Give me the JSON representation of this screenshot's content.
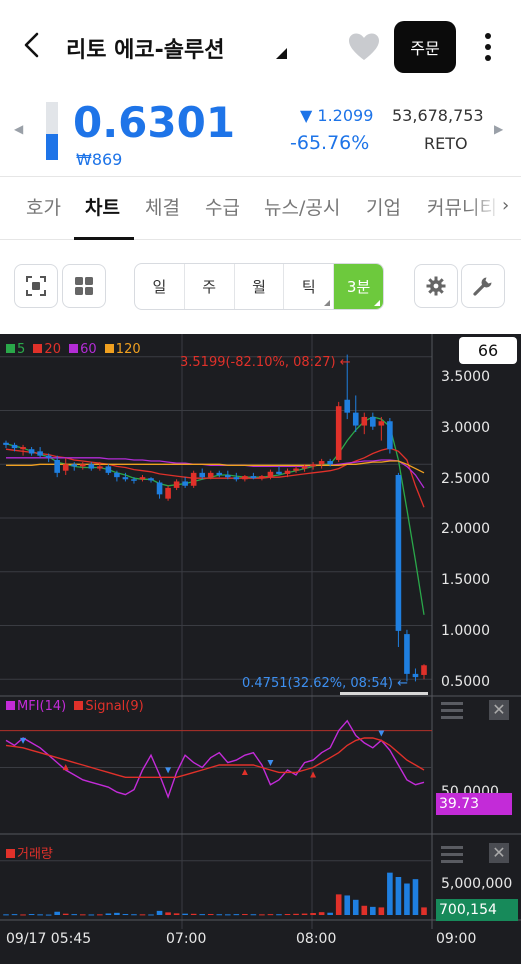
{
  "header": {
    "title": "리토 에코-솔루션",
    "order_label": "주문"
  },
  "quote": {
    "price": "0.6301",
    "prev_close": "₩869",
    "change": "▼ 1.2099",
    "change_rate": "-65.76%",
    "volume": "53,678,753",
    "ticker": "RETO",
    "gauge_level": 0.45
  },
  "tabs": [
    "호가",
    "차트",
    "체결",
    "수급",
    "뉴스/공시",
    "기업",
    "커뮤니티"
  ],
  "active_tab": "차트",
  "periods": [
    "일",
    "주",
    "월",
    "틱",
    "3분"
  ],
  "active_period": "3분",
  "chart": {
    "ma_legend": [
      {
        "label": "5",
        "color": "#2aa84a"
      },
      {
        "label": "20",
        "color": "#e0312a"
      },
      {
        "label": "60",
        "color": "#b32cd6"
      },
      {
        "label": "120",
        "color": "#f0a020"
      }
    ],
    "count_box": "66",
    "high_label": "3.5199(-82.10%, 08:27)",
    "low_label": "0.4751(32.62%, 08:54)",
    "price_ticks": [
      "3.5000",
      "3.0000",
      "2.5000",
      "2.0000",
      "1.5000",
      "1.0000",
      "0.5000"
    ],
    "mfi_legend": [
      "MFI(14)",
      "Signal(9)"
    ],
    "mfi_tick": "50.0000",
    "mfi_value": "39.73",
    "volume_legend": "거래량",
    "volume_tick": "5,000,000",
    "volume_value": "700,154",
    "x_labels": [
      "09/17 05:45",
      "07:00",
      "08:00",
      "09:00"
    ]
  },
  "chart_data": {
    "type": "candlestick",
    "interval": "3분",
    "ylim": [
      0.4,
      3.6
    ],
    "candles": [
      {
        "o": 2.7,
        "h": 2.72,
        "l": 2.65,
        "c": 2.68
      },
      {
        "o": 2.68,
        "h": 2.7,
        "l": 2.62,
        "c": 2.65
      },
      {
        "o": 2.64,
        "h": 2.68,
        "l": 2.58,
        "c": 2.66
      },
      {
        "o": 2.64,
        "h": 2.66,
        "l": 2.58,
        "c": 2.6
      },
      {
        "o": 2.62,
        "h": 2.66,
        "l": 2.56,
        "c": 2.58
      },
      {
        "o": 2.58,
        "h": 2.6,
        "l": 2.52,
        "c": 2.56
      },
      {
        "o": 2.54,
        "h": 2.58,
        "l": 2.38,
        "c": 2.42
      },
      {
        "o": 2.44,
        "h": 2.56,
        "l": 2.4,
        "c": 2.5
      },
      {
        "o": 2.5,
        "h": 2.52,
        "l": 2.44,
        "c": 2.48
      },
      {
        "o": 2.48,
        "h": 2.52,
        "l": 2.45,
        "c": 2.5
      },
      {
        "o": 2.5,
        "h": 2.52,
        "l": 2.44,
        "c": 2.46
      },
      {
        "o": 2.46,
        "h": 2.52,
        "l": 2.44,
        "c": 2.48
      },
      {
        "o": 2.48,
        "h": 2.5,
        "l": 2.4,
        "c": 2.42
      },
      {
        "o": 2.42,
        "h": 2.44,
        "l": 2.34,
        "c": 2.38
      },
      {
        "o": 2.38,
        "h": 2.42,
        "l": 2.34,
        "c": 2.36
      },
      {
        "o": 2.36,
        "h": 2.38,
        "l": 2.32,
        "c": 2.35
      },
      {
        "o": 2.36,
        "h": 2.4,
        "l": 2.34,
        "c": 2.38
      },
      {
        "o": 2.37,
        "h": 2.38,
        "l": 2.33,
        "c": 2.35
      },
      {
        "o": 2.33,
        "h": 2.35,
        "l": 2.18,
        "c": 2.22
      },
      {
        "o": 2.18,
        "h": 2.3,
        "l": 2.16,
        "c": 2.28
      },
      {
        "o": 2.28,
        "h": 2.36,
        "l": 2.26,
        "c": 2.34
      },
      {
        "o": 2.34,
        "h": 2.38,
        "l": 2.28,
        "c": 2.3
      },
      {
        "o": 2.3,
        "h": 2.44,
        "l": 2.28,
        "c": 2.42
      },
      {
        "o": 2.42,
        "h": 2.46,
        "l": 2.36,
        "c": 2.38
      },
      {
        "o": 2.38,
        "h": 2.44,
        "l": 2.36,
        "c": 2.42
      },
      {
        "o": 2.42,
        "h": 2.44,
        "l": 2.38,
        "c": 2.4
      },
      {
        "o": 2.4,
        "h": 2.44,
        "l": 2.36,
        "c": 2.38
      },
      {
        "o": 2.38,
        "h": 2.42,
        "l": 2.34,
        "c": 2.36
      },
      {
        "o": 2.36,
        "h": 2.4,
        "l": 2.34,
        "c": 2.39
      },
      {
        "o": 2.39,
        "h": 2.42,
        "l": 2.36,
        "c": 2.37
      },
      {
        "o": 2.37,
        "h": 2.4,
        "l": 2.35,
        "c": 2.39
      },
      {
        "o": 2.38,
        "h": 2.45,
        "l": 2.36,
        "c": 2.43
      },
      {
        "o": 2.43,
        "h": 2.48,
        "l": 2.4,
        "c": 2.41
      },
      {
        "o": 2.41,
        "h": 2.46,
        "l": 2.38,
        "c": 2.44
      },
      {
        "o": 2.44,
        "h": 2.48,
        "l": 2.42,
        "c": 2.46
      },
      {
        "o": 2.46,
        "h": 2.5,
        "l": 2.43,
        "c": 2.48
      },
      {
        "o": 2.48,
        "h": 2.52,
        "l": 2.45,
        "c": 2.5
      },
      {
        "o": 2.5,
        "h": 2.55,
        "l": 2.46,
        "c": 2.53
      },
      {
        "o": 2.53,
        "h": 2.55,
        "l": 2.48,
        "c": 2.5
      },
      {
        "o": 2.54,
        "h": 3.08,
        "l": 2.52,
        "c": 3.04
      },
      {
        "o": 3.1,
        "h": 3.52,
        "l": 2.92,
        "c": 2.98
      },
      {
        "o": 2.98,
        "h": 3.14,
        "l": 2.8,
        "c": 2.86
      },
      {
        "o": 2.86,
        "h": 2.98,
        "l": 2.78,
        "c": 2.94
      },
      {
        "o": 2.94,
        "h": 2.98,
        "l": 2.82,
        "c": 2.85
      },
      {
        "o": 2.86,
        "h": 2.94,
        "l": 2.72,
        "c": 2.9
      },
      {
        "o": 2.9,
        "h": 2.93,
        "l": 2.6,
        "c": 2.64
      },
      {
        "o": 2.4,
        "h": 2.42,
        "l": 0.8,
        "c": 0.95
      },
      {
        "o": 0.92,
        "h": 0.96,
        "l": 0.48,
        "c": 0.55
      },
      {
        "o": 0.55,
        "h": 0.6,
        "l": 0.48,
        "c": 0.52
      },
      {
        "o": 0.54,
        "h": 0.64,
        "l": 0.5,
        "c": 0.63
      }
    ],
    "ma": {
      "5": [
        2.69,
        2.67,
        2.65,
        2.62,
        2.59,
        2.57,
        2.52,
        2.5,
        2.48,
        2.47,
        2.47,
        2.47,
        2.45,
        2.42,
        2.4,
        2.37,
        2.36,
        2.36,
        2.32,
        2.3,
        2.31,
        2.32,
        2.34,
        2.36,
        2.38,
        2.4,
        2.4,
        2.39,
        2.38,
        2.38,
        2.38,
        2.39,
        2.4,
        2.42,
        2.44,
        2.46,
        2.48,
        2.5,
        2.5,
        2.6,
        2.72,
        2.82,
        2.9,
        2.94,
        2.92,
        2.85,
        2.54,
        2.08,
        1.6,
        1.1
      ],
      "20": [
        2.64,
        2.63,
        2.62,
        2.61,
        2.6,
        2.59,
        2.57,
        2.56,
        2.54,
        2.53,
        2.52,
        2.51,
        2.5,
        2.48,
        2.47,
        2.45,
        2.44,
        2.43,
        2.41,
        2.4,
        2.39,
        2.38,
        2.37,
        2.37,
        2.37,
        2.37,
        2.37,
        2.37,
        2.37,
        2.37,
        2.37,
        2.38,
        2.38,
        2.39,
        2.4,
        2.41,
        2.42,
        2.43,
        2.44,
        2.46,
        2.5,
        2.53,
        2.56,
        2.6,
        2.63,
        2.65,
        2.62,
        2.54,
        2.3,
        2.1
      ],
      "60": [
        2.56,
        2.56,
        2.56,
        2.56,
        2.56,
        2.56,
        2.56,
        2.56,
        2.56,
        2.56,
        2.56,
        2.56,
        2.55,
        2.55,
        2.55,
        2.54,
        2.54,
        2.53,
        2.53,
        2.52,
        2.51,
        2.51,
        2.5,
        2.5,
        2.49,
        2.49,
        2.49,
        2.49,
        2.49,
        2.48,
        2.48,
        2.48,
        2.48,
        2.48,
        2.48,
        2.48,
        2.49,
        2.49,
        2.49,
        2.5,
        2.51,
        2.52,
        2.53,
        2.53,
        2.54,
        2.54,
        2.53,
        2.48,
        2.4,
        2.28
      ],
      "120": [
        2.49,
        2.49,
        2.49,
        2.49,
        2.5,
        2.5,
        2.5,
        2.5,
        2.5,
        2.5,
        2.5,
        2.5,
        2.5,
        2.5,
        2.5,
        2.5,
        2.5,
        2.5,
        2.5,
        2.5,
        2.5,
        2.5,
        2.5,
        2.5,
        2.5,
        2.5,
        2.49,
        2.49,
        2.49,
        2.49,
        2.49,
        2.49,
        2.49,
        2.49,
        2.49,
        2.49,
        2.49,
        2.49,
        2.49,
        2.49,
        2.5,
        2.5,
        2.51,
        2.52,
        2.52,
        2.53,
        2.53,
        2.5,
        2.46,
        2.42
      ]
    },
    "mfi": [
      72,
      68,
      74,
      70,
      66,
      60,
      54,
      48,
      44,
      40,
      38,
      36,
      34,
      30,
      28,
      32,
      48,
      60,
      44,
      26,
      46,
      60,
      54,
      50,
      58,
      62,
      54,
      56,
      60,
      62,
      52,
      36,
      40,
      48,
      44,
      54,
      56,
      62,
      66,
      80,
      88,
      76,
      70,
      66,
      72,
      64,
      52,
      40,
      36,
      38
    ],
    "signal": [
      68,
      67,
      66,
      64,
      62,
      60,
      58,
      56,
      54,
      52,
      50,
      48,
      46,
      44,
      42,
      42,
      42,
      42,
      42,
      42,
      42,
      44,
      46,
      48,
      50,
      52,
      52,
      52,
      52,
      52,
      50,
      48,
      46,
      46,
      46,
      48,
      50,
      54,
      58,
      62,
      68,
      72,
      74,
      74,
      72,
      68,
      62,
      56,
      52,
      48
    ],
    "mfi_ylim": [
      0,
      100
    ],
    "volume": [
      60,
      80,
      50,
      90,
      60,
      40,
      300,
      120,
      80,
      60,
      50,
      60,
      140,
      200,
      90,
      70,
      60,
      50,
      380,
      240,
      150,
      120,
      110,
      80,
      90,
      70,
      60,
      80,
      90,
      70,
      60,
      80,
      70,
      90,
      110,
      130,
      180,
      260,
      210,
      1900,
      1800,
      1400,
      850,
      750,
      700,
      3900,
      3500,
      2900,
      3300,
      700
    ],
    "volume_ylim": [
      0,
      7000000
    ]
  }
}
